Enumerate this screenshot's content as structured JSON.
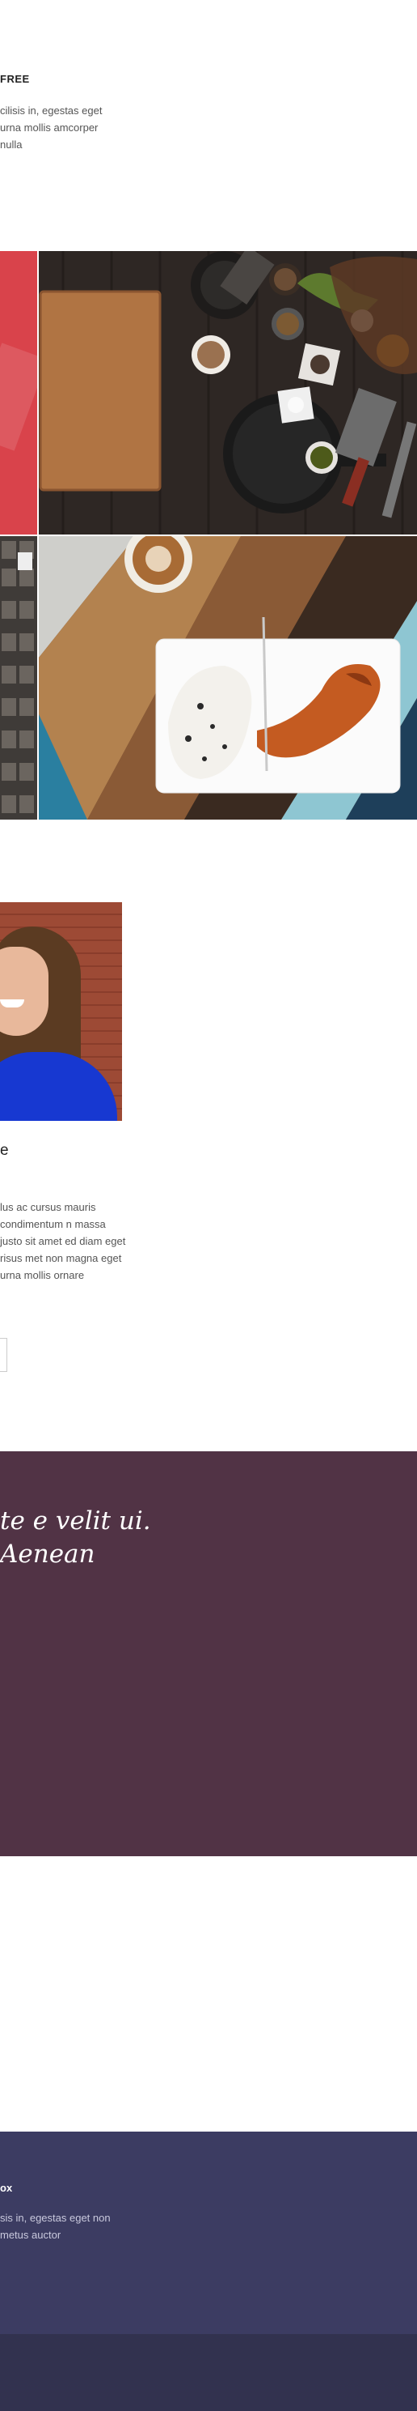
{
  "feature": {
    "heading": "FREE",
    "body": "cilisis in, egestas eget urna mollis amcorper nulla"
  },
  "gallery": {
    "tiles": [
      {
        "name": "red-texture-image"
      },
      {
        "name": "kitchen-still-life-image"
      },
      {
        "name": "letterpress-type-image"
      },
      {
        "name": "plated-food-image"
      }
    ]
  },
  "profile": {
    "name": "e",
    "bio": "lus ac cursus mauris condimentum n massa justo sit amet ed diam eget risus met non magna eget urna mollis ornare"
  },
  "quote": {
    "text": "te e velit ui. Aenean"
  },
  "infobox": {
    "heading": "ox",
    "body": "sis in, egestas eget non metus auctor"
  },
  "colors": {
    "quote_bg": "#513345",
    "infobox_bg": "#3c3c62",
    "footer_bg": "#32324f",
    "accent_red": "#d9434b"
  }
}
